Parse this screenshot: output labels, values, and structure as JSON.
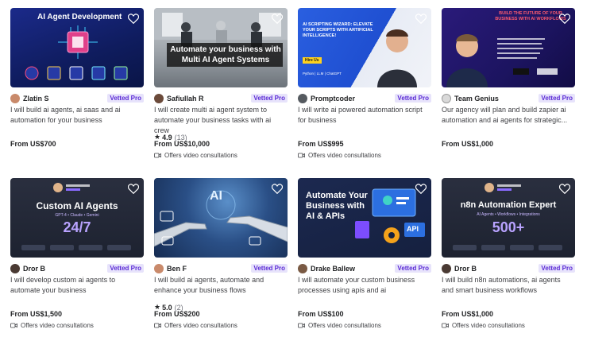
{
  "cards": [
    {
      "thumb_text": "AI Agent Development",
      "seller": "Zlatin S",
      "badge": "Vetted Pro",
      "title": "I will build ai agents, ai saas and ai automation for your business",
      "price": "From US$700"
    },
    {
      "thumb_text": "Automate your business with Multi AI Agent Systems",
      "seller": "Safiullah R",
      "badge": "Vetted Pro",
      "title": "I will create multi ai agent system to automate your business tasks with ai crew",
      "rating": "4.9",
      "rating_count": "(13)",
      "price": "From US$10,000",
      "consult": "Offers video consultations"
    },
    {
      "thumb_text": "AI SCRIPTING WIZARD: ELEVATE YOUR SCRIPTS WITH ARTIFICIAL INTELLIGENCE!",
      "thumb_hire": "Hire Us",
      "thumb_tags": "Python | LLM | ChatGPT",
      "seller": "Promptcoder",
      "badge": "Vetted Pro",
      "title": "I will write ai powered automation script for business",
      "price": "From US$995",
      "consult": "Offers video consultations"
    },
    {
      "thumb_text": "BUILD THE FUTURE OF YOUR BUSINESS WITH AI WORKFLOWS",
      "seller": "Team Genius",
      "badge": "Vetted Pro",
      "title": "Our agency will plan and build zapier ai automation and ai agents for strategic...",
      "price": "From US$1,000"
    },
    {
      "thumb_text": "Custom AI Agents",
      "thumb_sub": "GPT-4 • Claude • Gemini",
      "thumb_big": "24/7",
      "seller": "Dror B",
      "badge": "Vetted Pro",
      "title": "I will develop custom ai agents to automate your business",
      "price": "From US$1,500",
      "consult": "Offers video consultations"
    },
    {
      "thumb_text": "AI",
      "seller": "Ben F",
      "badge": "Vetted Pro",
      "title": "I will build ai agents, automate and enhance your business flows",
      "rating": "5.0",
      "rating_count": "(2)",
      "price": "From US$200",
      "consult": "Offers video consultations"
    },
    {
      "thumb_text": "Automate Your Business with AI & APIs",
      "thumb_api": "API",
      "seller": "Drake Ballew",
      "badge": "Vetted Pro",
      "title": "I will automate your custom business processes using apis and ai",
      "price": "From US$100",
      "consult": "Offers video consultations"
    },
    {
      "thumb_text": "n8n Automation Expert",
      "thumb_sub": "AI Agents • Workflows • Integrations",
      "thumb_big": "500+",
      "seller": "Dror B",
      "badge": "Vetted Pro",
      "title": "I will build n8n automations, ai agents and smart business workflows",
      "price": "From US$1,000",
      "consult": "Offers video consultations"
    }
  ],
  "colors": {
    "badge_bg": "#e7e3fb",
    "badge_text": "#5b2bd5"
  },
  "icons": [
    "heart-icon",
    "star-icon",
    "video-camera-icon"
  ]
}
